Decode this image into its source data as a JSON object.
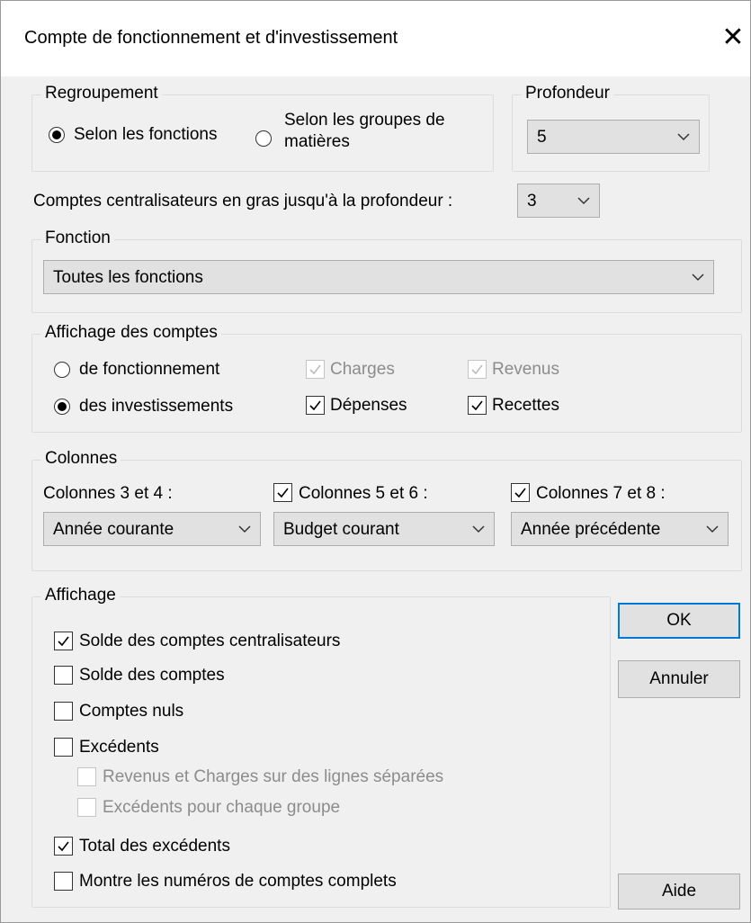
{
  "dialog": {
    "title": "Compte de fonctionnement et d'investissement",
    "close_symbol": "✕"
  },
  "regroupement": {
    "legend": "Regroupement",
    "option_fonctions": "Selon les fonctions",
    "option_matieres_line1": "Selon les groupes de",
    "option_matieres_line2": "matières",
    "selected": "fonctions"
  },
  "profondeur": {
    "legend": "Profondeur",
    "value": "5"
  },
  "centralisateurs": {
    "label": "Comptes centralisateurs en gras jusqu'à la profondeur :",
    "value": "3"
  },
  "fonction": {
    "legend": "Fonction",
    "value": "Toutes les fonctions"
  },
  "affichage_comptes": {
    "legend": "Affichage des comptes",
    "radio_fonctionnement": "de fonctionnement",
    "radio_investissements": "des investissements",
    "selected": "investissements",
    "charges": {
      "label": "Charges",
      "checked": true,
      "enabled": false
    },
    "revenus": {
      "label": "Revenus",
      "checked": true,
      "enabled": false
    },
    "depenses": {
      "label": "Dépenses",
      "checked": true,
      "enabled": true
    },
    "recettes": {
      "label": "Recettes",
      "checked": true,
      "enabled": true
    }
  },
  "colonnes": {
    "legend": "Colonnes",
    "col34_label": "Colonnes 3 et 4 :",
    "col34_value": "Année courante",
    "col56_label": "Colonnes 5 et 6 :",
    "col56_checked": true,
    "col56_value": "Budget courant",
    "col78_label": "Colonnes 7 et 8 :",
    "col78_checked": true,
    "col78_value": "Année précédente"
  },
  "affichage": {
    "legend": "Affichage",
    "items": [
      {
        "label": "Solde des comptes centralisateurs",
        "checked": true,
        "enabled": true
      },
      {
        "label": "Solde des comptes",
        "checked": false,
        "enabled": true
      },
      {
        "label": "Comptes nuls",
        "checked": false,
        "enabled": true
      },
      {
        "label": "Excédents",
        "checked": false,
        "enabled": true
      },
      {
        "label": "Revenus et Charges sur des lignes séparées",
        "checked": false,
        "enabled": false
      },
      {
        "label": "Excédents pour chaque groupe",
        "checked": false,
        "enabled": false
      },
      {
        "label": "Total des excédents",
        "checked": true,
        "enabled": true
      },
      {
        "label": "Montre les numéros de comptes complets",
        "checked": false,
        "enabled": true
      }
    ]
  },
  "buttons": {
    "ok": "OK",
    "annuler": "Annuler",
    "aide": "Aide"
  },
  "colors": {
    "dialog_bg": "#f0f0f0",
    "default_button_border": "#0078d7",
    "disabled_text": "#8c8c8c"
  }
}
